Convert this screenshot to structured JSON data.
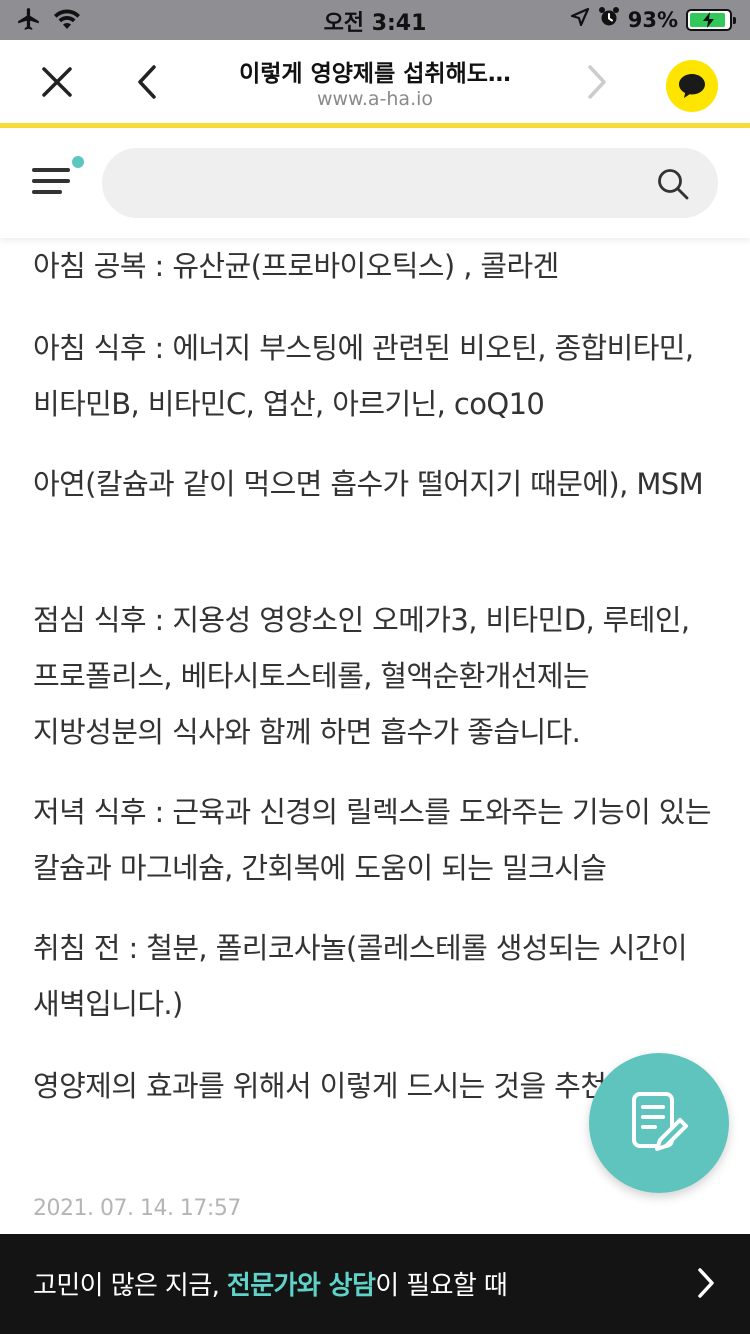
{
  "status_bar": {
    "time": "오전 3:41",
    "battery_percent": 93,
    "battery_label": "93%",
    "icons": [
      "airplane-icon",
      "wifi-icon",
      "location-icon",
      "alarm-icon",
      "battery-charging-icon"
    ]
  },
  "browser": {
    "title": "이렇게 영양제를 섭취해도…",
    "url": "www.a-ha.io",
    "accent_color": "#f5dc37",
    "chat_button_color": "#fee500"
  },
  "site_header": {
    "search_placeholder": "",
    "menu_badge_color": "#5cc6c0"
  },
  "article": {
    "paragraphs": [
      "아침 공복 : 유산균(프로바이오틱스) , 콜라겐",
      "아침 식후 : 에너지 부스팅에 관련된 비오틴, 종합비타민, 비타민B, 비타민C, 엽산, 아르기닌, coQ10",
      "아연(칼슘과 같이 먹으면 흡수가 떨어지기 때문에), MSM",
      "점심 식후 : 지용성 영양소인 오메가3, 비타민D, 루테인, 프로폴리스, 베타시토스테롤, 혈액순환개선제는 지방성분의 식사와 함께 하면 흡수가 좋습니다.",
      "저녁 식후 : 근육과 신경의 릴렉스를 도와주는 기능이 있는 칼슘과 마그네슘, 간회복에 도움이 되는 밀크시슬",
      "취침 전 : 철분, 폴리코사놀(콜레스테롤 생성되는 시간이 새벽입니다.)",
      "영양제의 효과를 위해서 이렇게 드시는 것을 추천드려요."
    ],
    "date": "2021. 07. 14. 17:57"
  },
  "fab": {
    "icon": "write-note-icon",
    "color": "#5fc4bd"
  },
  "bottom_banner": {
    "text_before": "고민이 많은 지금, ",
    "text_highlight": "전문가와 상담",
    "text_after": "이 필요할 때",
    "highlight_color": "#5fd2ca"
  }
}
